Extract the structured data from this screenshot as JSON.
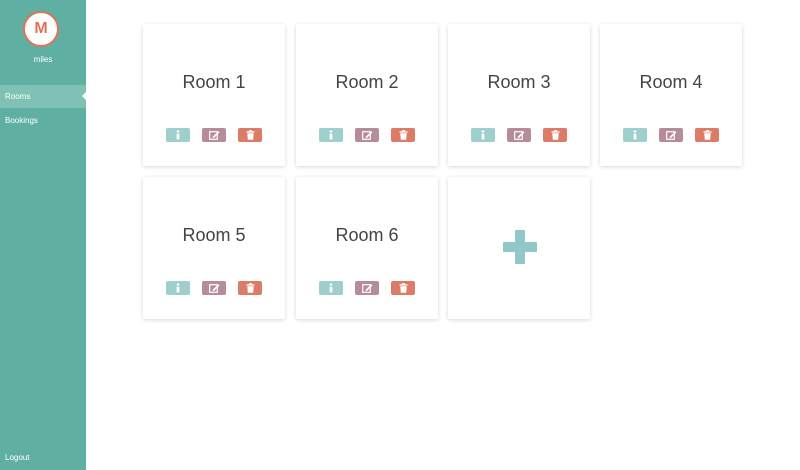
{
  "user": {
    "initial": "M",
    "name": "miles"
  },
  "sidebar": {
    "items": [
      {
        "label": "Rooms",
        "active": true
      },
      {
        "label": "Bookings",
        "active": false
      }
    ],
    "logout_label": "Logout"
  },
  "rooms": [
    {
      "title": "Room 1"
    },
    {
      "title": "Room 2"
    },
    {
      "title": "Room 3"
    },
    {
      "title": "Room 4"
    },
    {
      "title": "Room 5"
    },
    {
      "title": "Room 6"
    }
  ],
  "icons": {
    "info": "info-icon",
    "edit": "edit-icon",
    "delete": "trash-icon",
    "add": "plus-icon"
  },
  "colors": {
    "sidebar": "#5fb0a3",
    "sidebar_active": "#80c1b6",
    "avatar_accent": "#e07356",
    "info_button": "#9ecfcd",
    "edit_button": "#b68c9b",
    "delete_button": "#dc7c66",
    "add_icon": "#8fc8c6"
  }
}
